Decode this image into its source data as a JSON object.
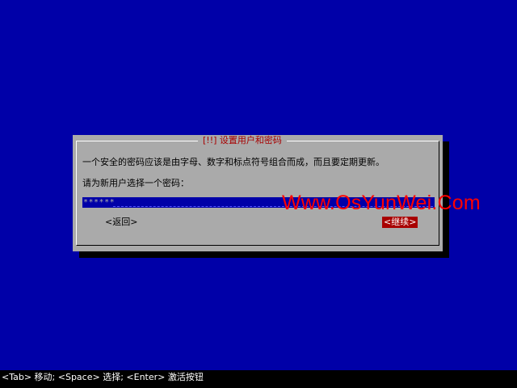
{
  "dialog": {
    "title": "[!!] 设置用户和密码",
    "description": "一个安全的密码应该是由字母、数字和标点符号组合而成，而且要定期更新。",
    "prompt": "请为新用户选择一个密码：",
    "password_value": "******",
    "back_label": "<返回>",
    "continue_label": "<继续>"
  },
  "watermark": "Www.OsYunWei.Com",
  "statusbar": {
    "text": "<Tab> 移动; <Space> 选择; <Enter> 激活按钮"
  },
  "colors": {
    "background": "#0000a8",
    "dialog": "#aaaaaa",
    "title": "#a80000",
    "selected_button": "#a80000",
    "watermark": "#ff0000"
  }
}
